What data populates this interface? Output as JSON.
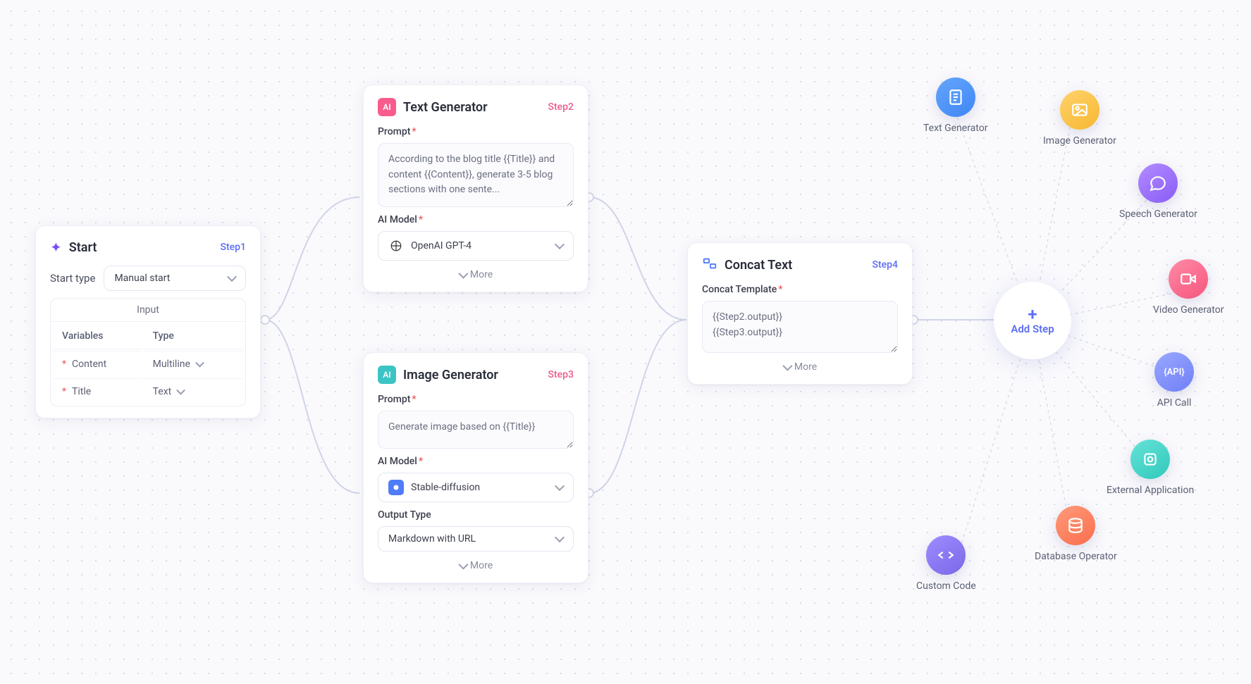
{
  "start": {
    "title": "Start",
    "step": "Step1",
    "startTypeLabel": "Start type",
    "startTypeValue": "Manual start",
    "inputHeader": "Input",
    "colVaria": "Variables",
    "colType": "Type",
    "rows": [
      {
        "name": "Content",
        "type": "Multiline"
      },
      {
        "name": "Title",
        "type": "Text"
      }
    ]
  },
  "textGen": {
    "title": "Text Generator",
    "step": "Step2",
    "promptLabel": "Prompt",
    "promptValue": "According to the blog title {{Title}} and content {{Content}}, generate 3-5 blog sections with one sente...",
    "modelLabel": "AI Model",
    "modelValue": "OpenAI GPT-4",
    "more": "More"
  },
  "imageGen": {
    "title": "Image Generator",
    "step": "Step3",
    "promptLabel": "Prompt",
    "promptValue": "Generate image based on {{Title}}",
    "modelLabel": "AI Model",
    "modelValue": "Stable-diffusion",
    "outputTypeLabel": "Output Type",
    "outputTypeValue": "Markdown with URL",
    "more": "More"
  },
  "concat": {
    "title": "Concat Text",
    "step": "Step4",
    "templateLabel": "Concat Template",
    "templateValue": "{{Step2.output}}\n{{Step3.output}}",
    "more": "More"
  },
  "radial": {
    "addStep": "Add Step",
    "items": [
      {
        "label": "Text Generator"
      },
      {
        "label": "Image Generator"
      },
      {
        "label": "Speech Generator"
      },
      {
        "label": "Video Generator"
      },
      {
        "label": "API Call"
      },
      {
        "label": "External Application"
      },
      {
        "label": "Database Operator"
      },
      {
        "label": "Custom Code"
      }
    ]
  },
  "icons": {
    "ai": "AI"
  }
}
